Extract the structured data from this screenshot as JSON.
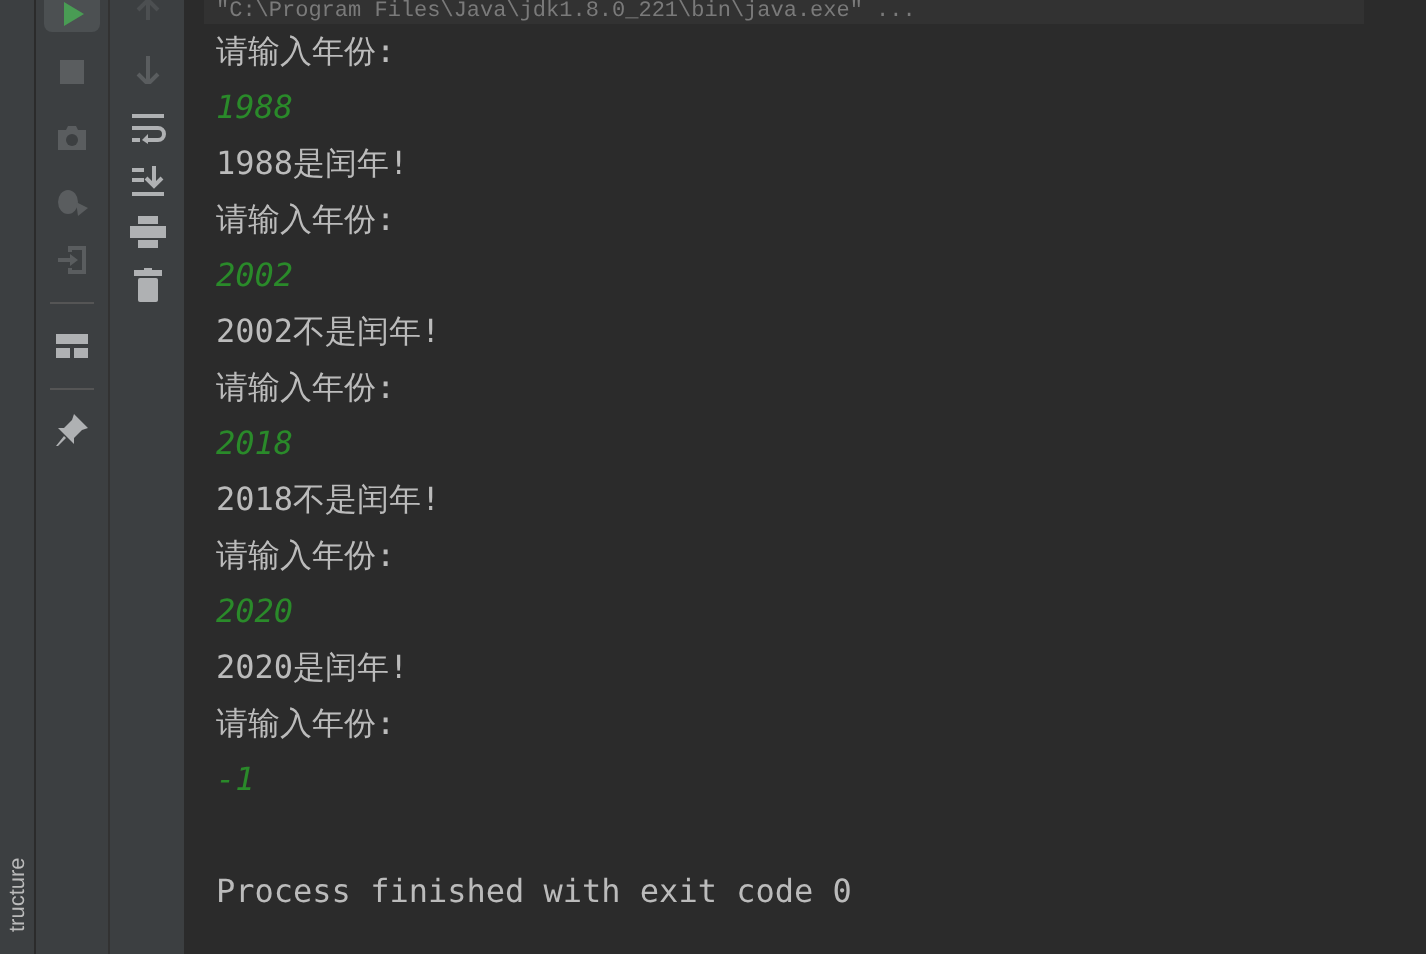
{
  "side_tab": {
    "label": "tructure"
  },
  "console": {
    "command": "\"C:\\Program Files\\Java\\jdk1.8.0_221\\bin\\java.exe\" ...",
    "lines": [
      {
        "kind": "prompt",
        "text": "请输入年份:"
      },
      {
        "kind": "input",
        "text": "1988"
      },
      {
        "kind": "output",
        "text": "1988是闰年!"
      },
      {
        "kind": "prompt",
        "text": "请输入年份:"
      },
      {
        "kind": "input",
        "text": "2002"
      },
      {
        "kind": "output",
        "text": "2002不是闰年!"
      },
      {
        "kind": "prompt",
        "text": "请输入年份:"
      },
      {
        "kind": "input",
        "text": "2018"
      },
      {
        "kind": "output",
        "text": "2018不是闰年!"
      },
      {
        "kind": "prompt",
        "text": "请输入年份:"
      },
      {
        "kind": "input",
        "text": "2020"
      },
      {
        "kind": "output",
        "text": "2020是闰年!"
      },
      {
        "kind": "prompt",
        "text": "请输入年份:"
      },
      {
        "kind": "input",
        "text": "-1"
      },
      {
        "kind": "blank"
      },
      {
        "kind": "output",
        "text": "Process finished with exit code 0"
      }
    ]
  }
}
